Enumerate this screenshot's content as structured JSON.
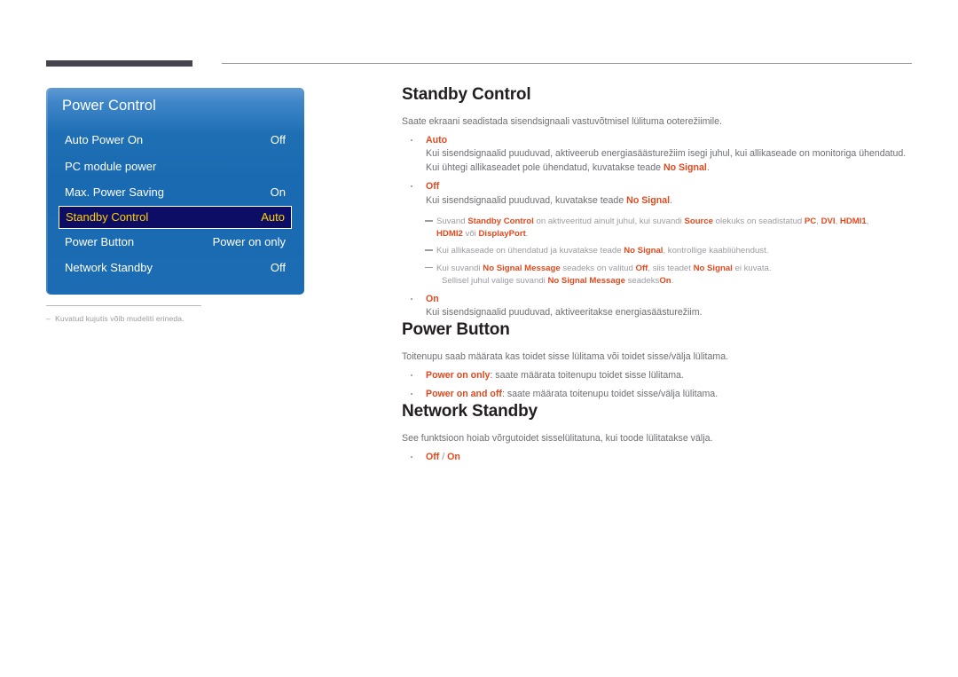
{
  "osd_menu": {
    "title": "Power Control",
    "rows": [
      {
        "label": "Auto Power On",
        "value": "Off",
        "selected": false
      },
      {
        "label": "PC module power",
        "value": "",
        "selected": false
      },
      {
        "label": "Max. Power Saving",
        "value": "On",
        "selected": false
      },
      {
        "label": "Standby Control",
        "value": "Auto",
        "selected": true
      },
      {
        "label": "Power Button",
        "value": "Power on only",
        "selected": false
      },
      {
        "label": "Network Standby",
        "value": "Off",
        "selected": false
      }
    ],
    "colors": {
      "panel_blue": "#1a6ab1",
      "selected_bg": "#0d0d66",
      "selected_text": "#ffd200"
    }
  },
  "footnote": {
    "dash": "–",
    "text": "Kuvatud kujutis võib mudeliti erineda."
  },
  "sections": {
    "standby_control": {
      "title": "Standby Control",
      "lead": "Saate ekraani seadistada sisendsignaali vastuvõtmisel lülituma ooterežiimile.",
      "bullet_auto": {
        "term": "Auto",
        "line1": "Kui sisendsignaalid puuduvad, aktiveerub energiasäästurežiim isegi juhul, kui allikaseade on monitoriga ühendatud.",
        "line2_pre": "Kui ühtegi allikaseadet pole ühendatud, kuvatakse teade ",
        "line2_term": "No Signal",
        "line2_post": "."
      },
      "bullet_off": {
        "term": "Off",
        "line1_pre": "Kui sisendsignaalid puuduvad, kuvatakse teade ",
        "line1_term": "No Signal",
        "line1_post": "."
      },
      "notes": [
        {
          "p1": "Suvand ",
          "t1": "Standby Control",
          "p2": " on aktiveeritud ainult juhul, kui suvandi ",
          "t2": "Source",
          "p3": " olekuks on seadistatud ",
          "t3": "PC",
          "p4": ", ",
          "t4": "DVI",
          "p5": ", ",
          "t5": "HDMI1",
          "p6": ",",
          "l2_t1": "HDMI2",
          "l2_p1": " või ",
          "l2_t2": "DisplayPort",
          "l2_p2": "."
        },
        {
          "p1": "Kui allikaseade on ühendatud ja kuvatakse teade ",
          "t1": "No Signal",
          "p2": ", kontrollige kaabliühendust."
        },
        {
          "p1": "Kui suvandi ",
          "t1": "No Signal Message",
          "p2": " seadeks on valitud ",
          "t2": "Off",
          "p3": ", siis teadet ",
          "t3": "No Signal",
          "p4": " ei kuvata.",
          "l2_p1": "Sellisel juhul valige suvandi ",
          "l2_t1": "No Signal Message",
          "l2_p2": " seadeks",
          "l2_t2": "On",
          "l2_p3": "."
        }
      ],
      "bullet_on": {
        "term": "On",
        "line1": "Kui sisendsignaalid puuduvad, aktiveeritakse energiasäästurežiim."
      }
    },
    "power_button": {
      "title": "Power Button",
      "lead": "Toitenupu saab määrata kas toidet sisse lülitama või toidet sisse/välja lülitama.",
      "bullets": [
        {
          "term": "Power on only",
          "rest": ": saate määrata toitenupu toidet sisse lülitama."
        },
        {
          "term": "Power on and off",
          "rest": ": saate määrata toitenupu toidet sisse/välja lülitama."
        }
      ]
    },
    "network_standby": {
      "title": "Network Standby",
      "lead": "See funktsioon hoiab võrgutoidet sisselülitatuna, kui toode lülitatakse välja.",
      "bullet": {
        "term_off": "Off",
        "slash": " / ",
        "term_on": "On"
      }
    }
  }
}
